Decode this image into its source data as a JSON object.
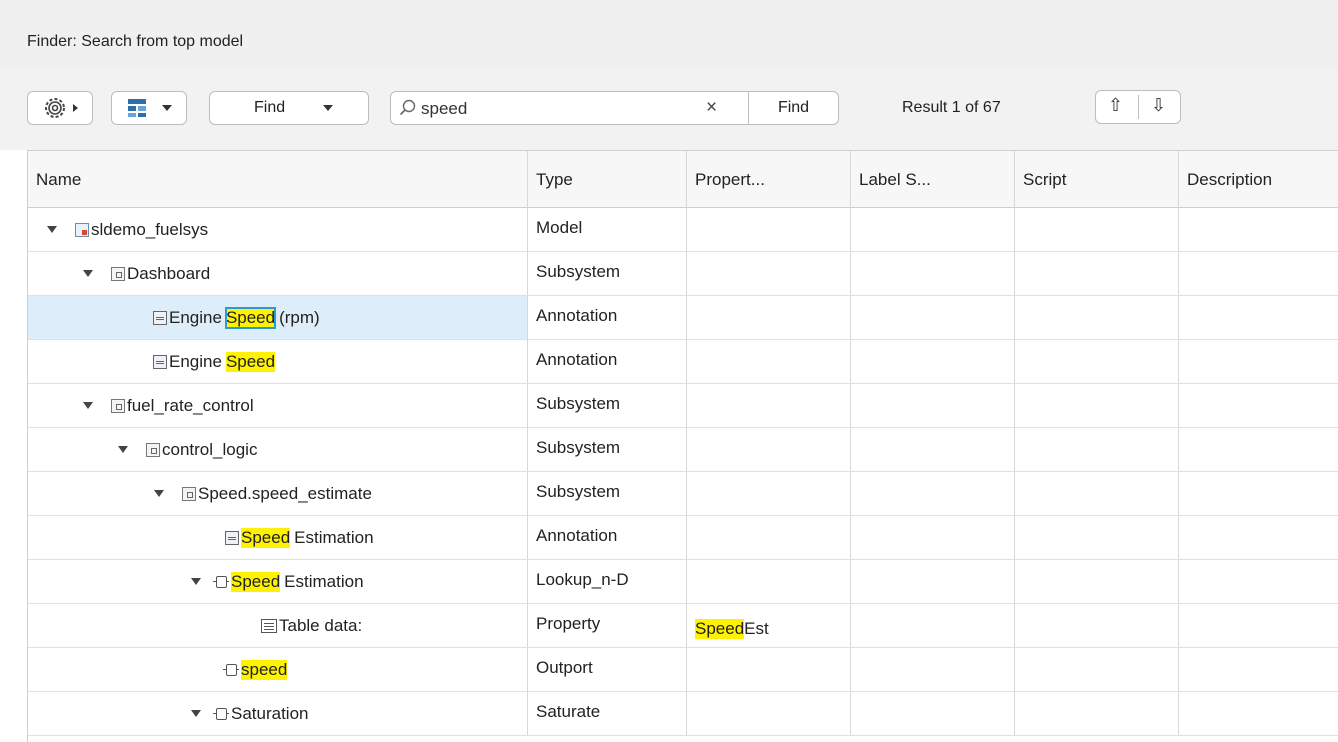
{
  "window": {
    "title": "Finder: Search from top model"
  },
  "toolbar": {
    "find_dropdown_label": "Find",
    "search_value": "speed",
    "search_clear": "×",
    "search_button_label": "Find",
    "result_text": "Result 1 of 67",
    "prev_arrow": "⇧",
    "next_arrow": "⇩"
  },
  "table": {
    "headers": [
      "Name",
      "Type",
      "Propert...",
      "Label S...",
      "Script",
      "Description"
    ],
    "rows": [
      {
        "pre": "sldemo_fuelsys",
        "match": "",
        "post": "",
        "type": "Model",
        "property": "",
        "property_rest": ""
      },
      {
        "pre": "Dashboard",
        "match": "",
        "post": "",
        "type": "Subsystem",
        "property": "",
        "property_rest": ""
      },
      {
        "pre": "Engine",
        "match": "Speed",
        "post": "(rpm)",
        "type": "Annotation",
        "property": "",
        "property_rest": ""
      },
      {
        "pre": "Engine",
        "match": "Speed",
        "post": "",
        "type": "Annotation",
        "property": "",
        "property_rest": ""
      },
      {
        "pre": "fuel_rate_control",
        "match": "",
        "post": "",
        "type": "Subsystem",
        "property": "",
        "property_rest": ""
      },
      {
        "pre": "control_logic",
        "match": "",
        "post": "",
        "type": "Subsystem",
        "property": "",
        "property_rest": ""
      },
      {
        "pre": "Speed.speed_estimate",
        "match": "",
        "post": "",
        "type": "Subsystem",
        "property": "",
        "property_rest": ""
      },
      {
        "pre": "",
        "match": "Speed",
        "post": "Estimation",
        "type": "Annotation",
        "property": "",
        "property_rest": ""
      },
      {
        "pre": "",
        "match": "Speed",
        "post": "Estimation",
        "type": "Lookup_n-D",
        "property": "",
        "property_rest": ""
      },
      {
        "pre": "Table data:",
        "match": "",
        "post": "",
        "type": "Property",
        "property": "Speed",
        "property_rest": "Est"
      },
      {
        "pre": "",
        "match": "speed",
        "post": "",
        "type": "Outport",
        "property": "",
        "property_rest": ""
      },
      {
        "pre": "Saturation",
        "match": "",
        "post": "",
        "type": "Saturate",
        "property": "",
        "property_rest": ""
      }
    ]
  },
  "colors": {
    "highlight": "#fff200",
    "selected_row": "#ddeefa",
    "toolbar_bg": "#f2f2f2"
  }
}
